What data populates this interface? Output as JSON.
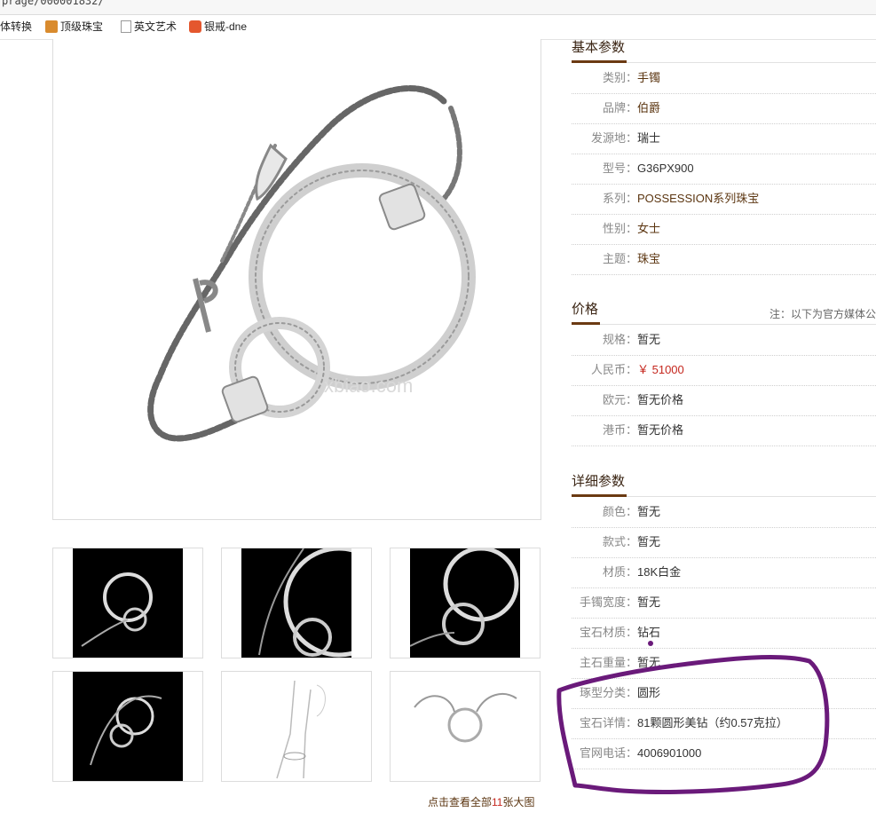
{
  "browser": {
    "url_fragment": "prage/000001832/",
    "bookmarks": [
      {
        "label": "体转换",
        "icon": "none"
      },
      {
        "label": "顶级珠宝",
        "icon": "jewelry-site-icon"
      },
      {
        "label": "英文艺术",
        "icon": "page-icon"
      },
      {
        "label": "银戒-dne",
        "icon": "taobao-icon"
      }
    ]
  },
  "gallery": {
    "main_watermark": "xbiao.com",
    "view_all": {
      "prefix": "点击查看全部",
      "count": "11",
      "suffix": "张大图"
    }
  },
  "basic": {
    "title": "基本参数",
    "rows": [
      {
        "label": "类别：",
        "value": "手镯",
        "link": true
      },
      {
        "label": "品牌：",
        "value": "伯爵",
        "link": true
      },
      {
        "label": "发源地：",
        "value": "瑞士",
        "link": false
      },
      {
        "label": "型号：",
        "value": "G36PX900",
        "link": false
      },
      {
        "label": "系列：",
        "value": "POSSESSION系列珠宝",
        "link": true
      },
      {
        "label": "性别：",
        "value": "女士",
        "link": true
      },
      {
        "label": "主题：",
        "value": "珠宝",
        "link": true
      }
    ]
  },
  "price": {
    "title": "价格",
    "note": "注：以下为官方媒体公",
    "rows": [
      {
        "label": "规格：",
        "value": "暂无"
      },
      {
        "label": "人民币：",
        "value": "￥ 51000"
      },
      {
        "label": "欧元：",
        "value": "暂无价格"
      },
      {
        "label": "港币：",
        "value": "暂无价格"
      }
    ]
  },
  "detail": {
    "title": "详细参数",
    "rows": [
      {
        "label": "颜色：",
        "value": "暂无"
      },
      {
        "label": "款式：",
        "value": "暂无"
      },
      {
        "label": "材质：",
        "value": "18K白金"
      },
      {
        "label": "手镯宽度：",
        "value": "暂无"
      },
      {
        "label": "宝石材质：",
        "value": "钻石"
      },
      {
        "label": "主石重量：",
        "value": "暂无"
      },
      {
        "label": "琢型分类：",
        "value": "圆形"
      },
      {
        "label": "宝石详情：",
        "value": "81颗圆形美钻（约0.57克拉）"
      },
      {
        "label": "官网电话：",
        "value": "4006901000"
      }
    ]
  },
  "colors": {
    "accent_brown": "#6b3a12",
    "price_red": "#c5271e",
    "annotation_purple": "#6a1a7a"
  }
}
